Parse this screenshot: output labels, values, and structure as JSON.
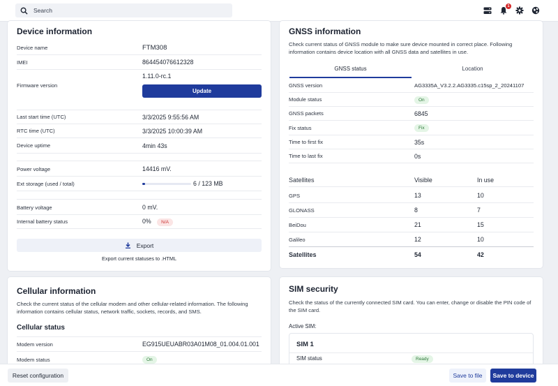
{
  "topbar": {
    "search_placeholder": "Search",
    "notification_count": "1",
    "icons": [
      "search-icon",
      "storage-icon",
      "bell-icon",
      "gear-icon",
      "globe-icon"
    ]
  },
  "device": {
    "title": "Device information",
    "rows": {
      "device_name": {
        "label": "Device name",
        "value": "FTM308"
      },
      "imei": {
        "label": "IMEI",
        "value": "864454076612328"
      },
      "firmware": {
        "label": "Firmware version",
        "value": "1.11.0-rc.1",
        "button": "Update"
      },
      "last_start": {
        "label": "Last start time (UTC)",
        "value": "3/3/2025 9:55:56 AM"
      },
      "rtc": {
        "label": "RTC time (UTC)",
        "value": "3/3/2025 10:00:39 AM"
      },
      "uptime": {
        "label": "Device uptime",
        "value": "4min 43s"
      },
      "power": {
        "label": "Power voltage",
        "value": "14416 mV."
      },
      "storage": {
        "label": "Ext storage (used / total)",
        "value": "6 / 123 MB",
        "fraction": 0.05
      },
      "battery": {
        "label": "Battery voltage",
        "value": "0 mV."
      },
      "internal_battery": {
        "label": "Internal battery status",
        "value": "0%",
        "badge": "N/A"
      }
    },
    "export_button": "Export",
    "export_caption": "Export current statuses to .HTML"
  },
  "gnss": {
    "title": "GNSS information",
    "description": "Check current status of GNSS module to make sure device mounted in correct place. Following information contains device location with all GNSS data and satellites in use.",
    "tabs": [
      "GNSS status",
      "Location"
    ],
    "rows": {
      "version": {
        "label": "GNSS version",
        "value": "AG3335A_V3.2.2.AG3335.c15sp_2_20241107"
      },
      "module": {
        "label": "Module status",
        "value": "On"
      },
      "packets": {
        "label": "GNSS packets",
        "value": "6845"
      },
      "fix": {
        "label": "Fix status",
        "value": "Fix"
      },
      "first_fix": {
        "label": "Time to first fix",
        "value": "35s"
      },
      "last_fix": {
        "label": "Time to last fix",
        "value": "0s"
      }
    },
    "satellites": {
      "headers": [
        "Satellites",
        "Visible",
        "In use"
      ],
      "rows": [
        {
          "name": "GPS",
          "visible": "13",
          "in_use": "10"
        },
        {
          "name": "GLONASS",
          "visible": "8",
          "in_use": "7"
        },
        {
          "name": "BeiDou",
          "visible": "21",
          "in_use": "15"
        },
        {
          "name": "Galileo",
          "visible": "12",
          "in_use": "10"
        }
      ],
      "total": {
        "name": "Satellites",
        "visible": "54",
        "in_use": "42"
      }
    }
  },
  "cellular": {
    "title": "Cellular information",
    "description": "Check the current status of the cellular modem and other cellular-related information. The following information contains cellular status, network traffic, sockets, records, and SMS.",
    "subtitle": "Cellular status",
    "rows": {
      "modem_version": {
        "label": "Modem version",
        "value": "EG915UEUABR03A01M08_01.004.01.001"
      },
      "modem_status": {
        "label": "Modem status",
        "value": "On"
      }
    }
  },
  "sim": {
    "title": "SIM security",
    "description": "Check the status of the currently connected SIM card. You can enter, change or disable the PIN code of the SIM card.",
    "active_label": "Active SIM:",
    "card_title": "SIM 1",
    "status_label": "SIM status",
    "status_value": "Ready"
  },
  "footer": {
    "reset": "Reset configuration",
    "save_file": "Save to file",
    "save_device": "Save to device"
  }
}
